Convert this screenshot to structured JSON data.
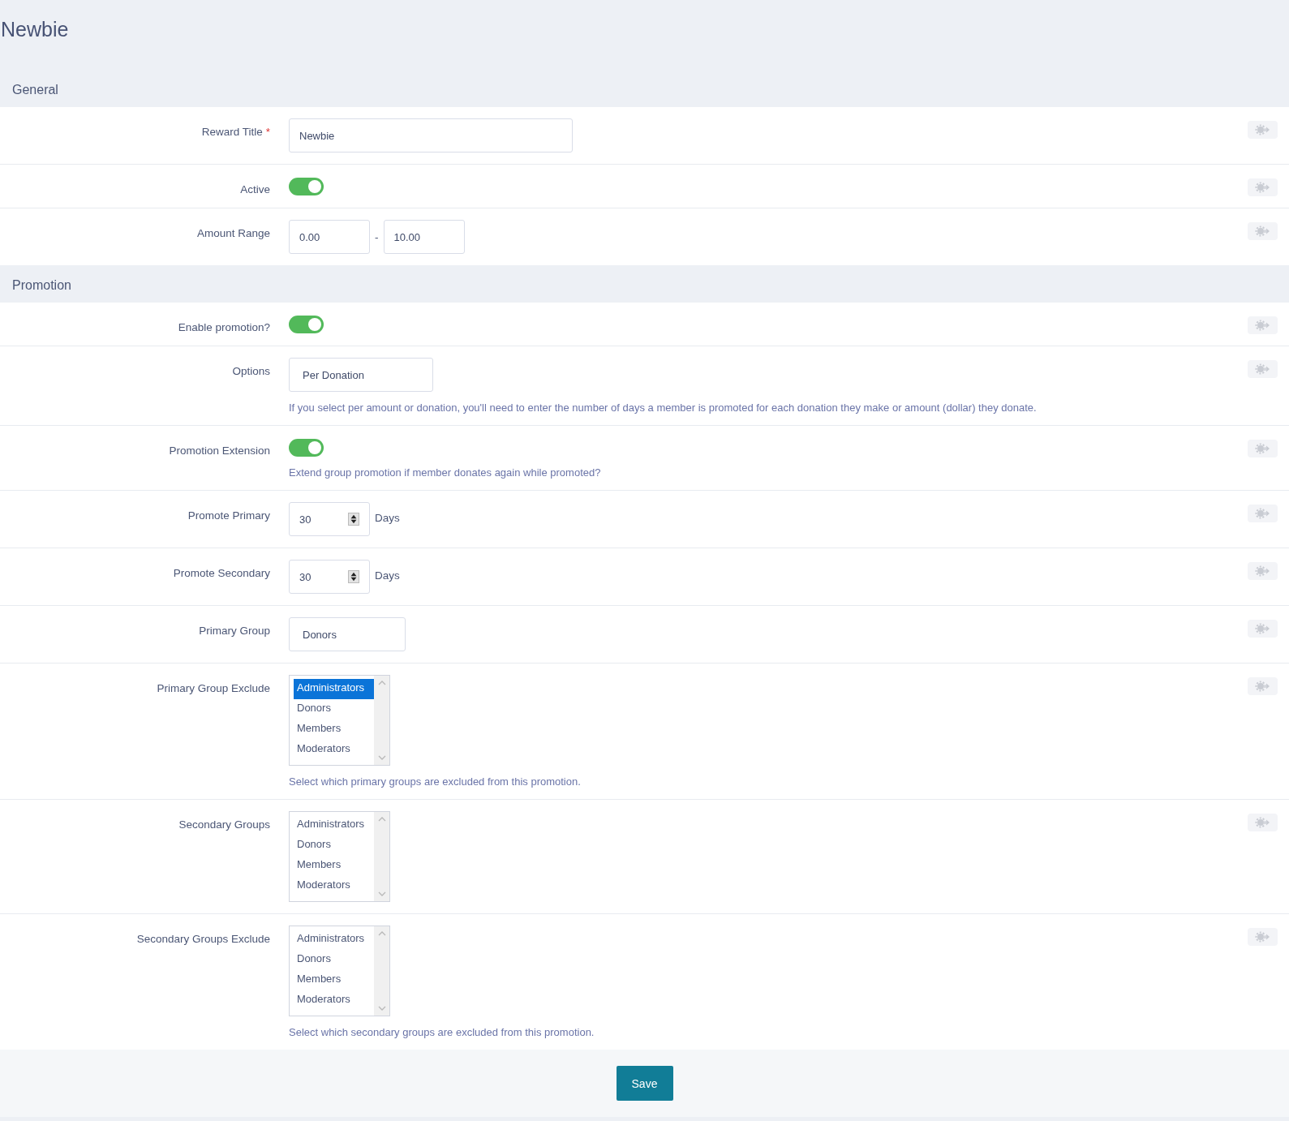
{
  "title": "Newbie",
  "sections": [
    {
      "title": "General",
      "rows": [
        {
          "kind": "text",
          "label": "Reward Title",
          "required_mark": "*",
          "value": "Newbie"
        },
        {
          "kind": "toggle",
          "label": "Active",
          "on": true
        },
        {
          "kind": "range",
          "label": "Amount Range",
          "from": "0.00",
          "separator": "-",
          "to": "10.00"
        }
      ]
    },
    {
      "title": "Promotion",
      "rows": [
        {
          "kind": "toggle",
          "label": "Enable promotion?",
          "on": true
        },
        {
          "kind": "select",
          "label": "Options",
          "value": "Per Donation",
          "help": "If you select per amount or donation, you'll need to enter the number of days a member is promoted for each donation they make or amount (dollar) they donate."
        },
        {
          "kind": "toggle",
          "label": "Promotion Extension",
          "on": true,
          "help": "Extend group promotion if member donates again while promoted?"
        },
        {
          "kind": "number",
          "label": "Promote Primary",
          "value": "30",
          "unit": "Days"
        },
        {
          "kind": "number",
          "label": "Promote Secondary",
          "value": "30",
          "unit": "Days"
        },
        {
          "kind": "select",
          "label": "Primary Group",
          "value": "Donors"
        },
        {
          "kind": "listbox",
          "label": "Primary Group Exclude",
          "options": [
            {
              "label": "Administrators",
              "selected": true
            },
            {
              "label": "Donors",
              "selected": false
            },
            {
              "label": "Members",
              "selected": false
            },
            {
              "label": "Moderators",
              "selected": false
            }
          ],
          "help": "Select which primary groups are excluded from this promotion."
        },
        {
          "kind": "listbox",
          "label": "Secondary Groups",
          "options": [
            {
              "label": "Administrators",
              "selected": false
            },
            {
              "label": "Donors",
              "selected": false
            },
            {
              "label": "Members",
              "selected": false
            },
            {
              "label": "Moderators",
              "selected": false
            }
          ]
        },
        {
          "kind": "listbox",
          "label": "Secondary Groups Exclude",
          "options": [
            {
              "label": "Administrators",
              "selected": false
            },
            {
              "label": "Donors",
              "selected": false
            },
            {
              "label": "Members",
              "selected": false
            },
            {
              "label": "Moderators",
              "selected": false
            }
          ],
          "help": "Select which secondary groups are excluded from this promotion."
        }
      ]
    }
  ],
  "save_button": "Save"
}
